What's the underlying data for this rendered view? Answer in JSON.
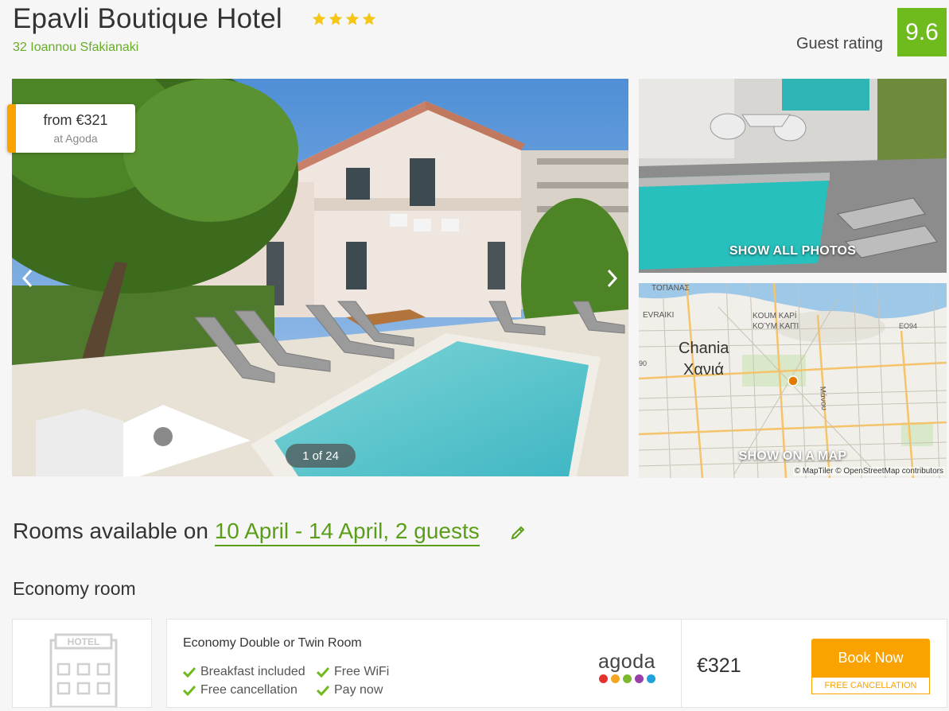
{
  "hotel": {
    "name": "Epavli Boutique Hotel",
    "star_count": 4,
    "address": "32 Ioannou Sfakianaki",
    "guest_rating_label": "Guest rating",
    "guest_rating": "9.6"
  },
  "gallery": {
    "price_from": "from €321",
    "price_source": "at Agoda",
    "counter": "1 of 24",
    "show_all_photos": "SHOW ALL PHOTOS",
    "show_on_map": "SHOW ON A MAP",
    "map_credit": "© MapTiler © OpenStreetMap contributors",
    "map_labels": {
      "topanas": "ΤΟΠΑΝΑΣ",
      "evraiki": "EVRAIKI",
      "koum_kapi_lat": "KOUM KAPÍ",
      "koum_kapi_gr": "ΚΟΎΜ ΚΑΠΊ",
      "eo94": "EO94",
      "chania_lat": "Chania",
      "chania_gr": "Χανιά",
      "road_90": "90",
      "manou": "Μάνου"
    }
  },
  "rooms": {
    "heading_prefix": "Rooms available on ",
    "dates": "10 April - 14 April, 2 guests",
    "room_type": "Economy room",
    "hotel_placeholder": "HOTEL",
    "offer": {
      "name": "Economy Double or Twin Room",
      "features": [
        "Breakfast included",
        "Free WiFi",
        "Free cancellation",
        "Pay now"
      ],
      "provider": "agoda",
      "provider_dot_colors": [
        "#e5322d",
        "#f5a623",
        "#7cb82f",
        "#9b3fa8",
        "#1fa2dc"
      ],
      "price": "€321",
      "book_label": "Book Now",
      "free_cancellation": "FREE CANCELLATION"
    }
  },
  "colors": {
    "accent_green": "#6fba1d",
    "link_green": "#5a9e18",
    "orange": "#f9a200"
  }
}
